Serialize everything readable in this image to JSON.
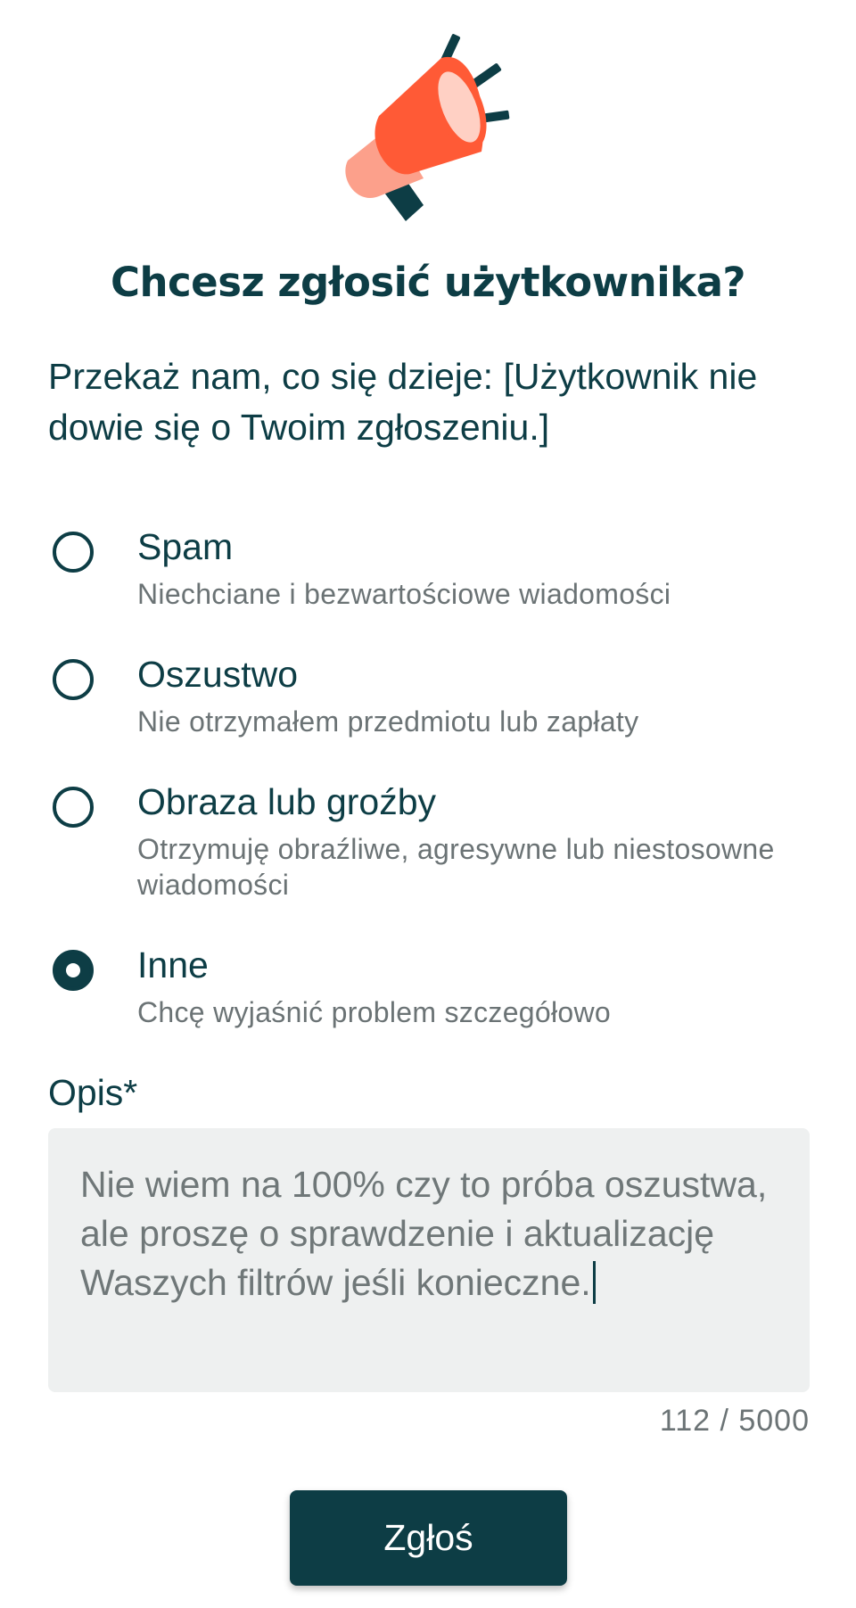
{
  "dialog": {
    "title": "Chcesz zgłosić użytkownika?",
    "intro": "Przekaż nam, co się dzieje: [Użytkownik nie dowie się o Twoim zgłoszeniu.]"
  },
  "reasons": [
    {
      "label": "Spam",
      "description": "Niechciane i bezwartościowe wiadomości",
      "selected": false
    },
    {
      "label": "Oszustwo",
      "description": "Nie otrzymałem przedmiotu lub zapłaty",
      "selected": false
    },
    {
      "label": "Obraza lub groźby",
      "description": "Otrzymuję obraźliwe, agresywne lub niestosowne wiadomości",
      "selected": false
    },
    {
      "label": "Inne",
      "description": "Chcę wyjaśnić problem szczegółowo",
      "selected": true
    }
  ],
  "description_field": {
    "label": "Opis*",
    "value": "Nie wiem na 100% czy to próba oszustwa, ale proszę o sprawdzenie i aktualizację Waszych filtrów jeśli konieczne.",
    "counter": "112 / 5000"
  },
  "submit": {
    "label": "Zgłoś"
  },
  "icons": {
    "hero": "megaphone-icon"
  },
  "colors": {
    "primary": "#0d3d45",
    "accent": "#ff5a36",
    "accent_light": "#fca08b",
    "muted_text": "#6b7375",
    "field_bg": "#eef0f0"
  }
}
